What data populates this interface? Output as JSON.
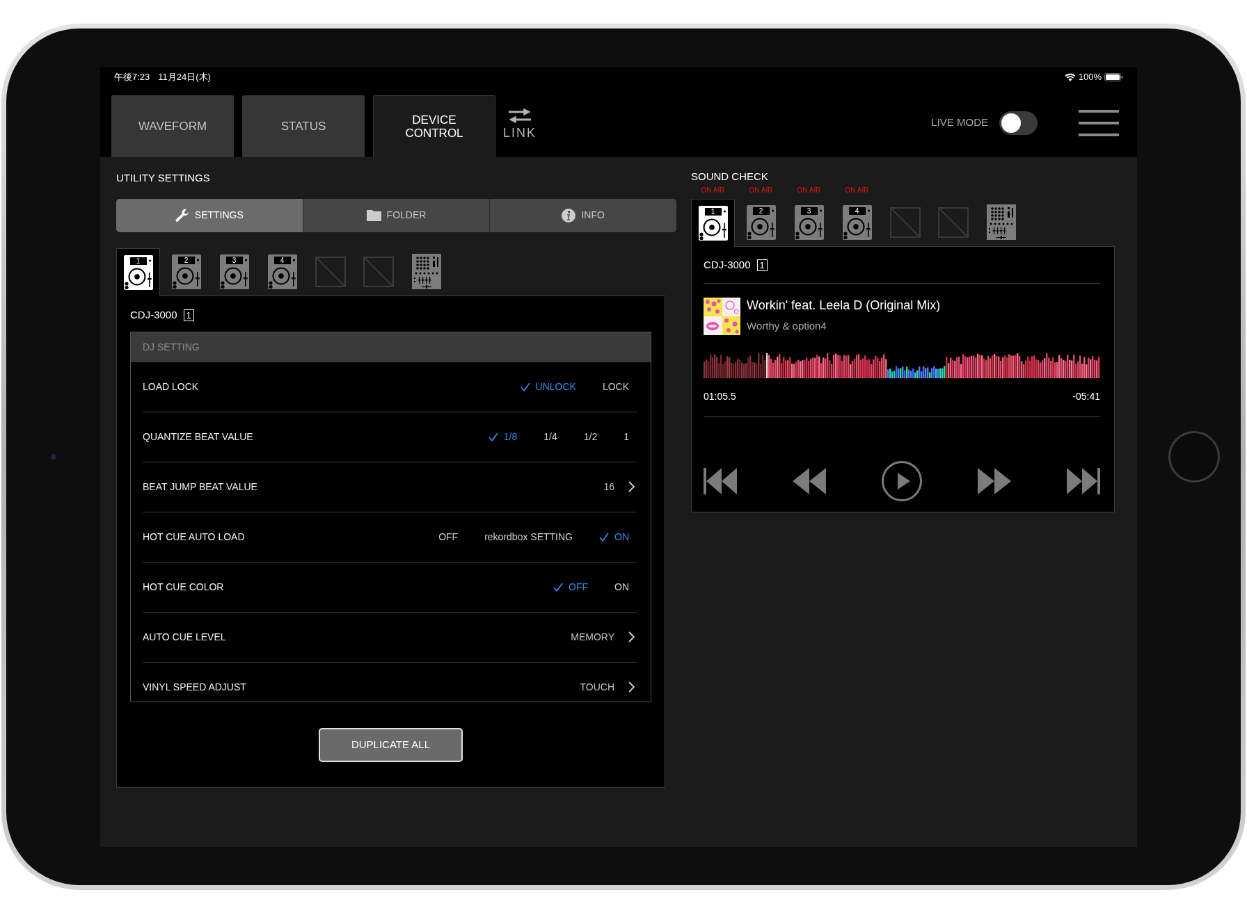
{
  "status_bar": {
    "time": "午後7:23",
    "date": "11月24日(木)",
    "battery": "100%"
  },
  "header": {
    "tabs": [
      {
        "label": "WAVEFORM",
        "selected": false
      },
      {
        "label": "STATUS",
        "selected": false
      },
      {
        "label": "DEVICE CONTROL",
        "selected": true
      }
    ],
    "link": {
      "label": "LINK"
    },
    "live_mode": {
      "label": "LIVE MODE",
      "on": false
    }
  },
  "utility_settings": {
    "title": "UTILITY SETTINGS",
    "tabs": [
      {
        "kind": "settings",
        "label": "SETTINGS",
        "selected": true
      },
      {
        "kind": "folder",
        "label": "FOLDER",
        "selected": false
      },
      {
        "kind": "info",
        "label": "INFO",
        "selected": false
      }
    ],
    "devices": [
      {
        "kind": "player",
        "number": "1",
        "selected": true
      },
      {
        "kind": "player",
        "number": "2",
        "selected": false
      },
      {
        "kind": "player",
        "number": "3",
        "selected": false
      },
      {
        "kind": "player",
        "number": "4",
        "selected": false
      },
      {
        "kind": "empty",
        "selected": false
      },
      {
        "kind": "empty",
        "selected": false
      },
      {
        "kind": "mixer",
        "selected": false
      }
    ],
    "device_name": "CDJ-3000",
    "device_number": "1",
    "section": "DJ SETTING",
    "rows": [
      {
        "kind": "options",
        "label": "LOAD LOCK",
        "options": [
          {
            "label": "UNLOCK",
            "selected": true
          },
          {
            "label": "LOCK",
            "selected": false
          }
        ]
      },
      {
        "kind": "options",
        "label": "QUANTIZE BEAT VALUE",
        "options": [
          {
            "label": "1/8",
            "selected": true
          },
          {
            "label": "1/4",
            "selected": false
          },
          {
            "label": "1/2",
            "selected": false
          },
          {
            "label": "1",
            "selected": false
          }
        ]
      },
      {
        "kind": "link",
        "label": "BEAT JUMP BEAT VALUE",
        "value": "16"
      },
      {
        "kind": "options",
        "label": "HOT CUE AUTO LOAD",
        "options": [
          {
            "label": "OFF",
            "selected": false
          },
          {
            "label": "rekordbox SETTING",
            "selected": false
          },
          {
            "label": "ON",
            "selected": true
          }
        ]
      },
      {
        "kind": "options",
        "label": "HOT CUE COLOR",
        "options": [
          {
            "label": "OFF",
            "selected": true
          },
          {
            "label": "ON",
            "selected": false
          }
        ]
      },
      {
        "kind": "link",
        "label": "AUTO CUE LEVEL",
        "value": "MEMORY"
      },
      {
        "kind": "link",
        "label": "VINYL SPEED ADJUST",
        "value": "TOUCH"
      }
    ],
    "duplicate_button": "DUPLICATE ALL"
  },
  "sound_check": {
    "title": "SOUND CHECK",
    "devices": [
      {
        "kind": "player",
        "number": "1",
        "badge": "ON AIR",
        "selected": true
      },
      {
        "kind": "player",
        "number": "2",
        "badge": "ON AIR",
        "selected": false
      },
      {
        "kind": "player",
        "number": "3",
        "badge": "ON AIR",
        "selected": false
      },
      {
        "kind": "player",
        "number": "4",
        "badge": "ON AIR",
        "selected": false
      },
      {
        "kind": "empty",
        "selected": false
      },
      {
        "kind": "empty",
        "selected": false
      },
      {
        "kind": "mixer",
        "selected": false
      }
    ],
    "device_name": "CDJ-3000",
    "device_number": "1",
    "track": {
      "title": "Workin' feat. Leela D (Original Mix)",
      "artist": "Worthy & option4"
    },
    "waveform": {
      "level": 0.16
    },
    "elapsed": "01:05.5",
    "remaining": "-05:41"
  }
}
